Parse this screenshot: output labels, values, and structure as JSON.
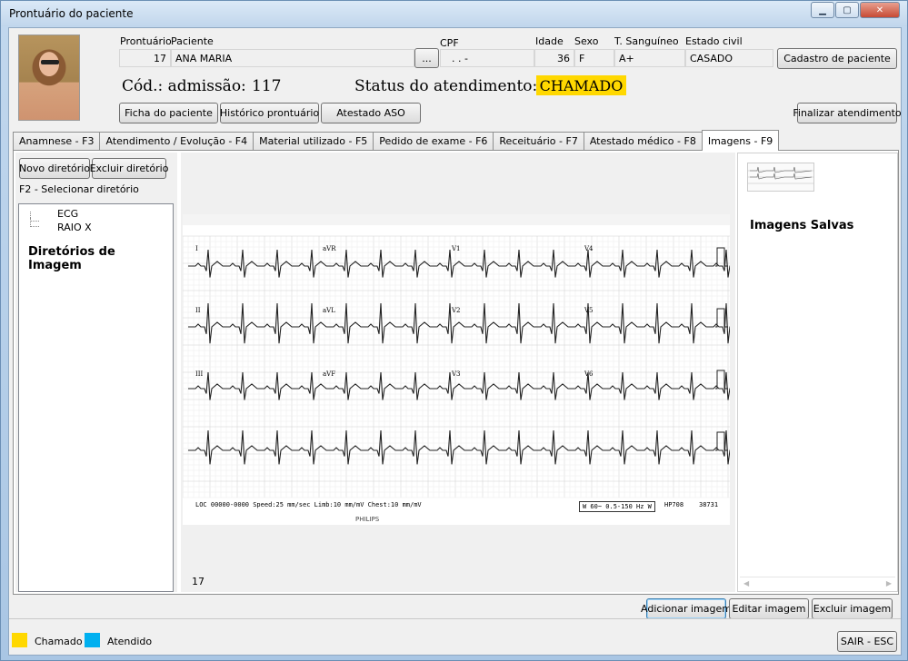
{
  "window": {
    "title": "Prontuário do paciente",
    "controls": {
      "minimize": "▁",
      "maximize": "▢",
      "close": "✕"
    }
  },
  "patient": {
    "labels": {
      "prontuario": "Prontuário",
      "paciente": "Paciente",
      "cpf": "CPF",
      "idade": "Idade",
      "sexo": "Sexo",
      "tipo_sanguineo": "T. Sanguíneo",
      "estado_civil": "Estado civil"
    },
    "values": {
      "prontuario": "17",
      "paciente": "ANA MARIA",
      "cpf": ". . -",
      "idade": "36",
      "sexo": "F",
      "tipo_sanguineo": "A+",
      "estado_civil": "CASADO"
    },
    "ellipsis_button": "...",
    "cadastro_button": "Cadastro de paciente"
  },
  "admission": {
    "cod_label": "Cód.: admissão:",
    "cod_value": "117",
    "status_label": "Status do atendimento:",
    "status_value": "CHAMADO",
    "status_color": "#FFD800"
  },
  "actions": {
    "ficha": "Ficha do paciente",
    "historico": "Histórico prontuário",
    "atestado_aso": "Atestado ASO",
    "finalizar": "Finalizar atendimento"
  },
  "tabs": [
    {
      "label": "Anamnese - F3"
    },
    {
      "label": "Atendimento / Evolução - F4"
    },
    {
      "label": "Material utilizado - F5"
    },
    {
      "label": "Pedido de exame - F6"
    },
    {
      "label": "Receituário - F7"
    },
    {
      "label": "Atestado médico - F8"
    },
    {
      "label": "Imagens - F9",
      "active": true
    }
  ],
  "images_tab": {
    "novo_diretorio": "Novo diretório",
    "excluir_diretorio": "Excluir diretório",
    "hint": "F2 - Selecionar diretório",
    "directories": [
      "ECG",
      "RAIO X"
    ],
    "directories_title": "Diretórios de Imagem",
    "image_count": "17",
    "saved_title": "Imagens Salvas",
    "ecg": {
      "leads": [
        "I",
        "aVR",
        "V1",
        "V4",
        "II",
        "aVL",
        "V2",
        "V5",
        "III",
        "aVF",
        "V3",
        "V6"
      ],
      "footer_left": "LOC 00000-0000  Speed:25 mm/sec  Limb:10 mm/mV  Chest:10 mm/mV",
      "footer_right": "W 60~ 0.5-150 Hz W",
      "model": "HP708",
      "number": "38731",
      "brand": "PHILIPS"
    }
  },
  "image_buttons": {
    "adicionar": "Adicionar imagem",
    "editar": "Editar imagem",
    "excluir": "Excluir imagem"
  },
  "legend": [
    {
      "label": "Chamado",
      "color": "#FFD800"
    },
    {
      "label": "Atendido",
      "color": "#00B0F0"
    }
  ],
  "exit_button": "SAIR - ESC"
}
